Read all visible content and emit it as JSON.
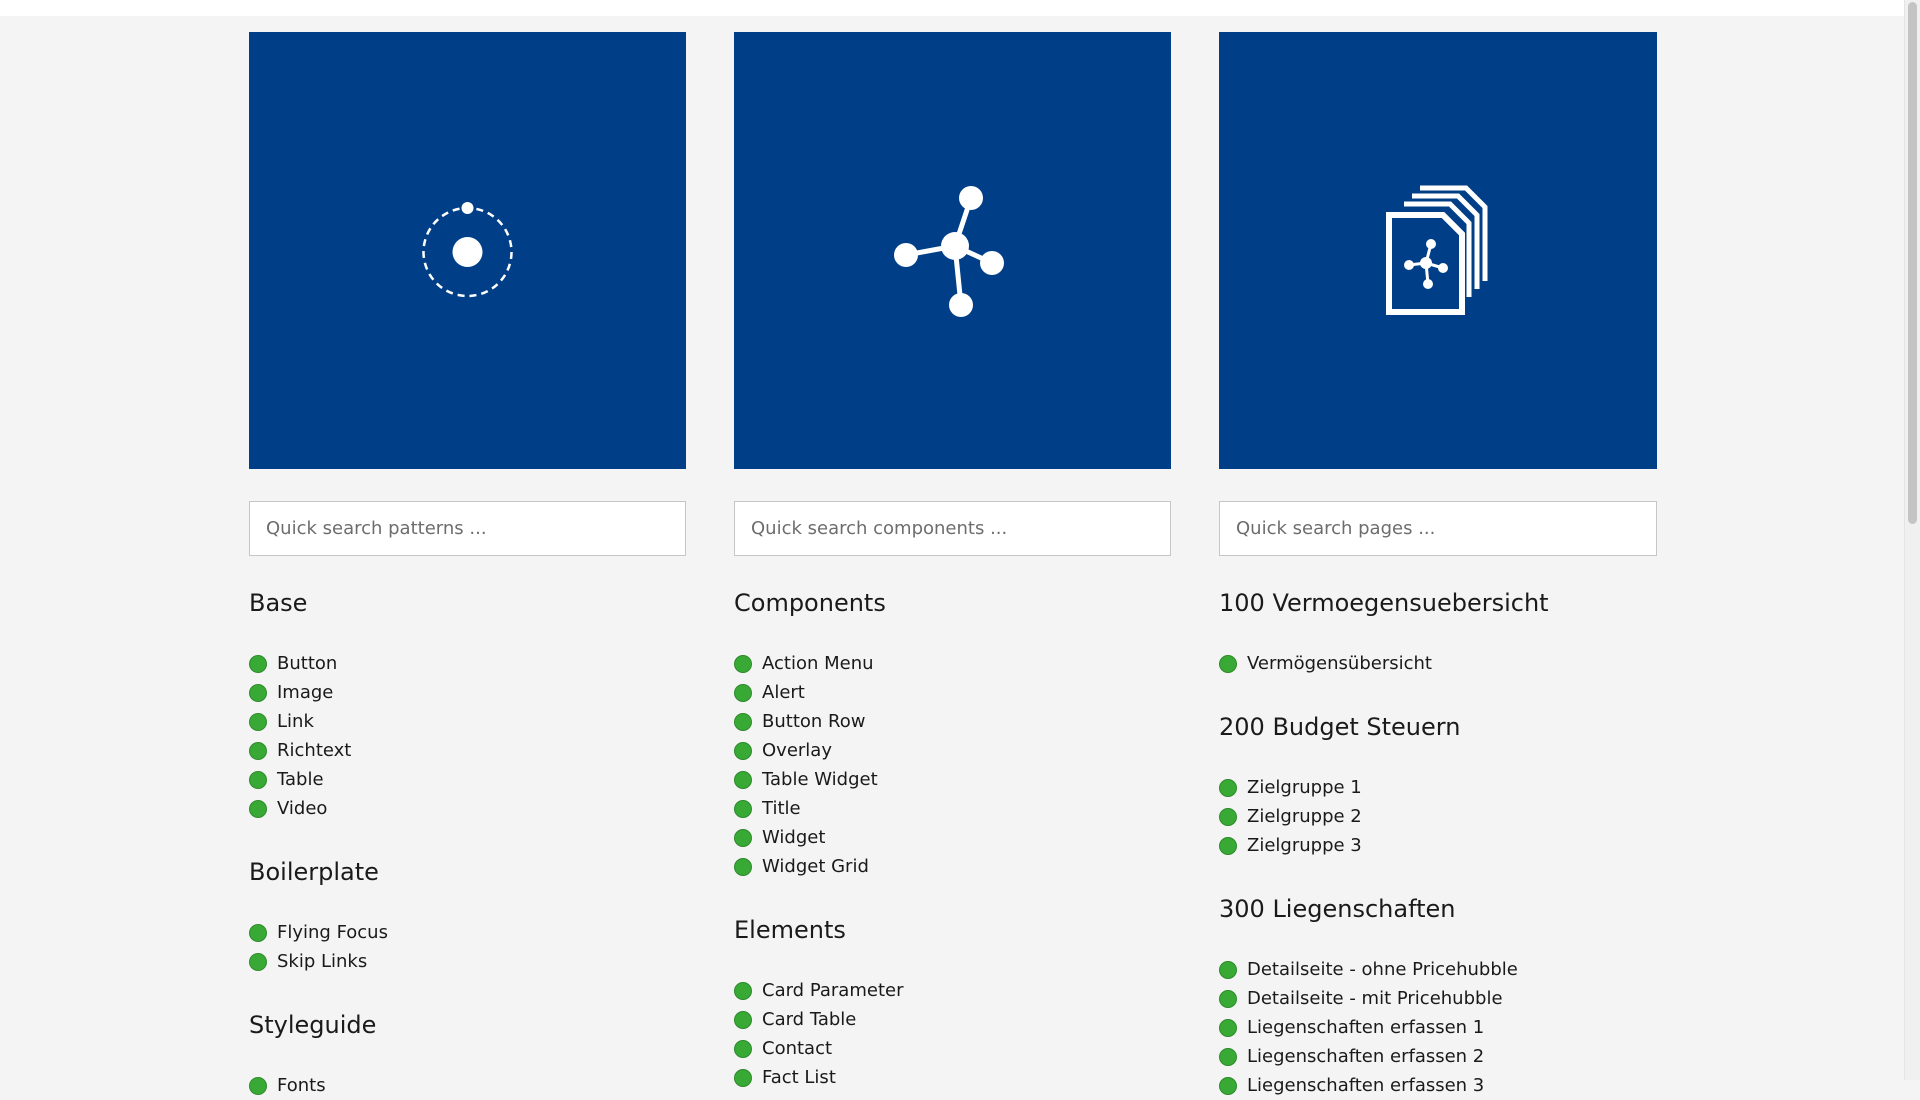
{
  "colors": {
    "tile_bg": "#003f87",
    "status_dot": "#39a935",
    "page_bg": "#f4f4f4"
  },
  "columns": [
    {
      "tile_icon": "orbit-icon",
      "search": {
        "placeholder": "Quick search patterns ..."
      },
      "sections": [
        {
          "title": "Base",
          "items": [
            "Button",
            "Image",
            "Link",
            "Richtext",
            "Table",
            "Video"
          ]
        },
        {
          "title": "Boilerplate",
          "items": [
            "Flying Focus",
            "Skip Links"
          ]
        },
        {
          "title": "Styleguide",
          "items": [
            "Fonts"
          ]
        }
      ]
    },
    {
      "tile_icon": "component-graph-icon",
      "search": {
        "placeholder": "Quick search components ..."
      },
      "sections": [
        {
          "title": "Components",
          "items": [
            "Action Menu",
            "Alert",
            "Button Row",
            "Overlay",
            "Table Widget",
            "Title",
            "Widget",
            "Widget Grid"
          ]
        },
        {
          "title": "Elements",
          "items": [
            "Card Parameter",
            "Card Table",
            "Contact",
            "Fact List"
          ]
        }
      ]
    },
    {
      "tile_icon": "pages-stack-icon",
      "search": {
        "placeholder": "Quick search pages ..."
      },
      "sections": [
        {
          "title": "100 Vermoegensuebersicht",
          "items": [
            "Vermögensübersicht"
          ]
        },
        {
          "title": "200 Budget Steuern",
          "items": [
            "Zielgruppe 1",
            "Zielgruppe 2",
            "Zielgruppe 3"
          ]
        },
        {
          "title": "300 Liegenschaften",
          "items": [
            "Detailseite - ohne Pricehubble",
            "Detailseite - mit Pricehubble",
            "Liegenschaften erfassen 1",
            "Liegenschaften erfassen 2",
            "Liegenschaften erfassen 3"
          ]
        }
      ]
    }
  ]
}
